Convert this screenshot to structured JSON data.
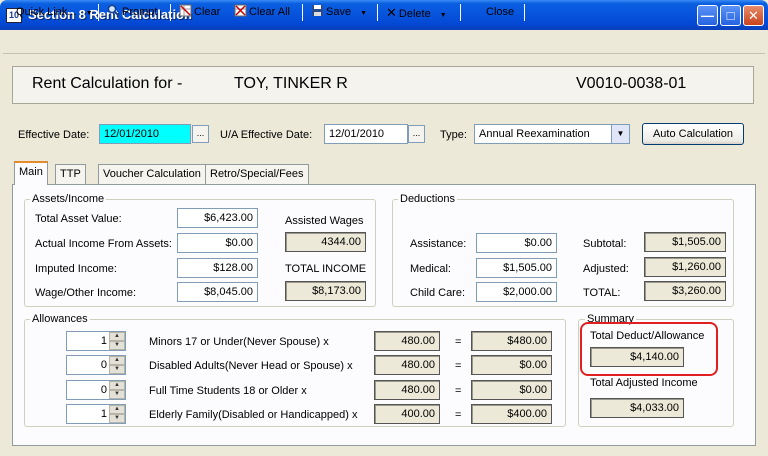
{
  "window": {
    "title": "Section 8 Rent Calculation",
    "icon": "app-icon",
    "icon_text": "10"
  },
  "toolbar": {
    "quick_link": "Quick Link...",
    "prompt": "Prompt",
    "clear": "Clear",
    "clear_all": "Clear All",
    "save": "Save",
    "delete": "Delete",
    "close": "Close"
  },
  "header": {
    "label": "Rent Calculation for -",
    "tenant": "TOY, TINKER R",
    "voucher": "V0010-0038-01"
  },
  "dates": {
    "effective_label": "Effective Date:",
    "effective_value": "12/01/2010",
    "ua_label": "U/A Effective Date:",
    "ua_value": "12/01/2010",
    "type_label": "Type:",
    "type_value": "Annual Reexamination",
    "auto_calc": "Auto Calculation",
    "ellipsis": "..."
  },
  "tabs": [
    "Main",
    "TTP",
    "Voucher Calculation",
    "Retro/Special/Fees"
  ],
  "assets": {
    "title": "Assets/Income",
    "rows": [
      {
        "label": "Total Asset Value:",
        "value": "$6,423.00"
      },
      {
        "label": "Actual Income From Assets:",
        "value": "$0.00"
      },
      {
        "label": "Imputed Income:",
        "value": "$128.00"
      },
      {
        "label": "Wage/Other Income:",
        "value": "$8,045.00"
      }
    ],
    "assisted_wages_label": "Assisted Wages",
    "assisted_wages_value": "4344.00",
    "total_income_label": "TOTAL INCOME",
    "total_income_value": "$8,173.00"
  },
  "deductions": {
    "title": "Deductions",
    "rows": [
      {
        "label": "Assistance:",
        "value": "$0.00"
      },
      {
        "label": "Medical:",
        "value": "$1,505.00"
      },
      {
        "label": "Child Care:",
        "value": "$2,000.00"
      }
    ],
    "subtotal_label": "Subtotal:",
    "subtotal_value": "$1,505.00",
    "adjusted_label": "Adjusted:",
    "adjusted_value": "$1,260.00",
    "total_label": "TOTAL:",
    "total_value": "$3,260.00"
  },
  "allowances": {
    "title": "Allowances",
    "equals": "=",
    "rows": [
      {
        "count": "1",
        "label": "Minors 17 or Under(Never Spouse)  x",
        "rate": "480.00",
        "total": "$480.00"
      },
      {
        "count": "0",
        "label": "Disabled Adults(Never Head or Spouse)  x",
        "rate": "480.00",
        "total": "$0.00"
      },
      {
        "count": "0",
        "label": "Full Time Students 18 or Older  x",
        "rate": "480.00",
        "total": "$0.00"
      },
      {
        "count": "1",
        "label": "Elderly Family(Disabled or Handicapped)  x",
        "rate": "400.00",
        "total": "$400.00"
      }
    ]
  },
  "summary": {
    "title": "Summary",
    "deduct_label": "Total Deduct/Allowance",
    "deduct_value": "$4,140.00",
    "adjusted_income_label": "Total Adjusted Income",
    "adjusted_income_value": "$4,033.00"
  },
  "colors": {
    "title_bar": "#0855DD",
    "highlight": "#E02020",
    "selection": "#00FFFF"
  }
}
